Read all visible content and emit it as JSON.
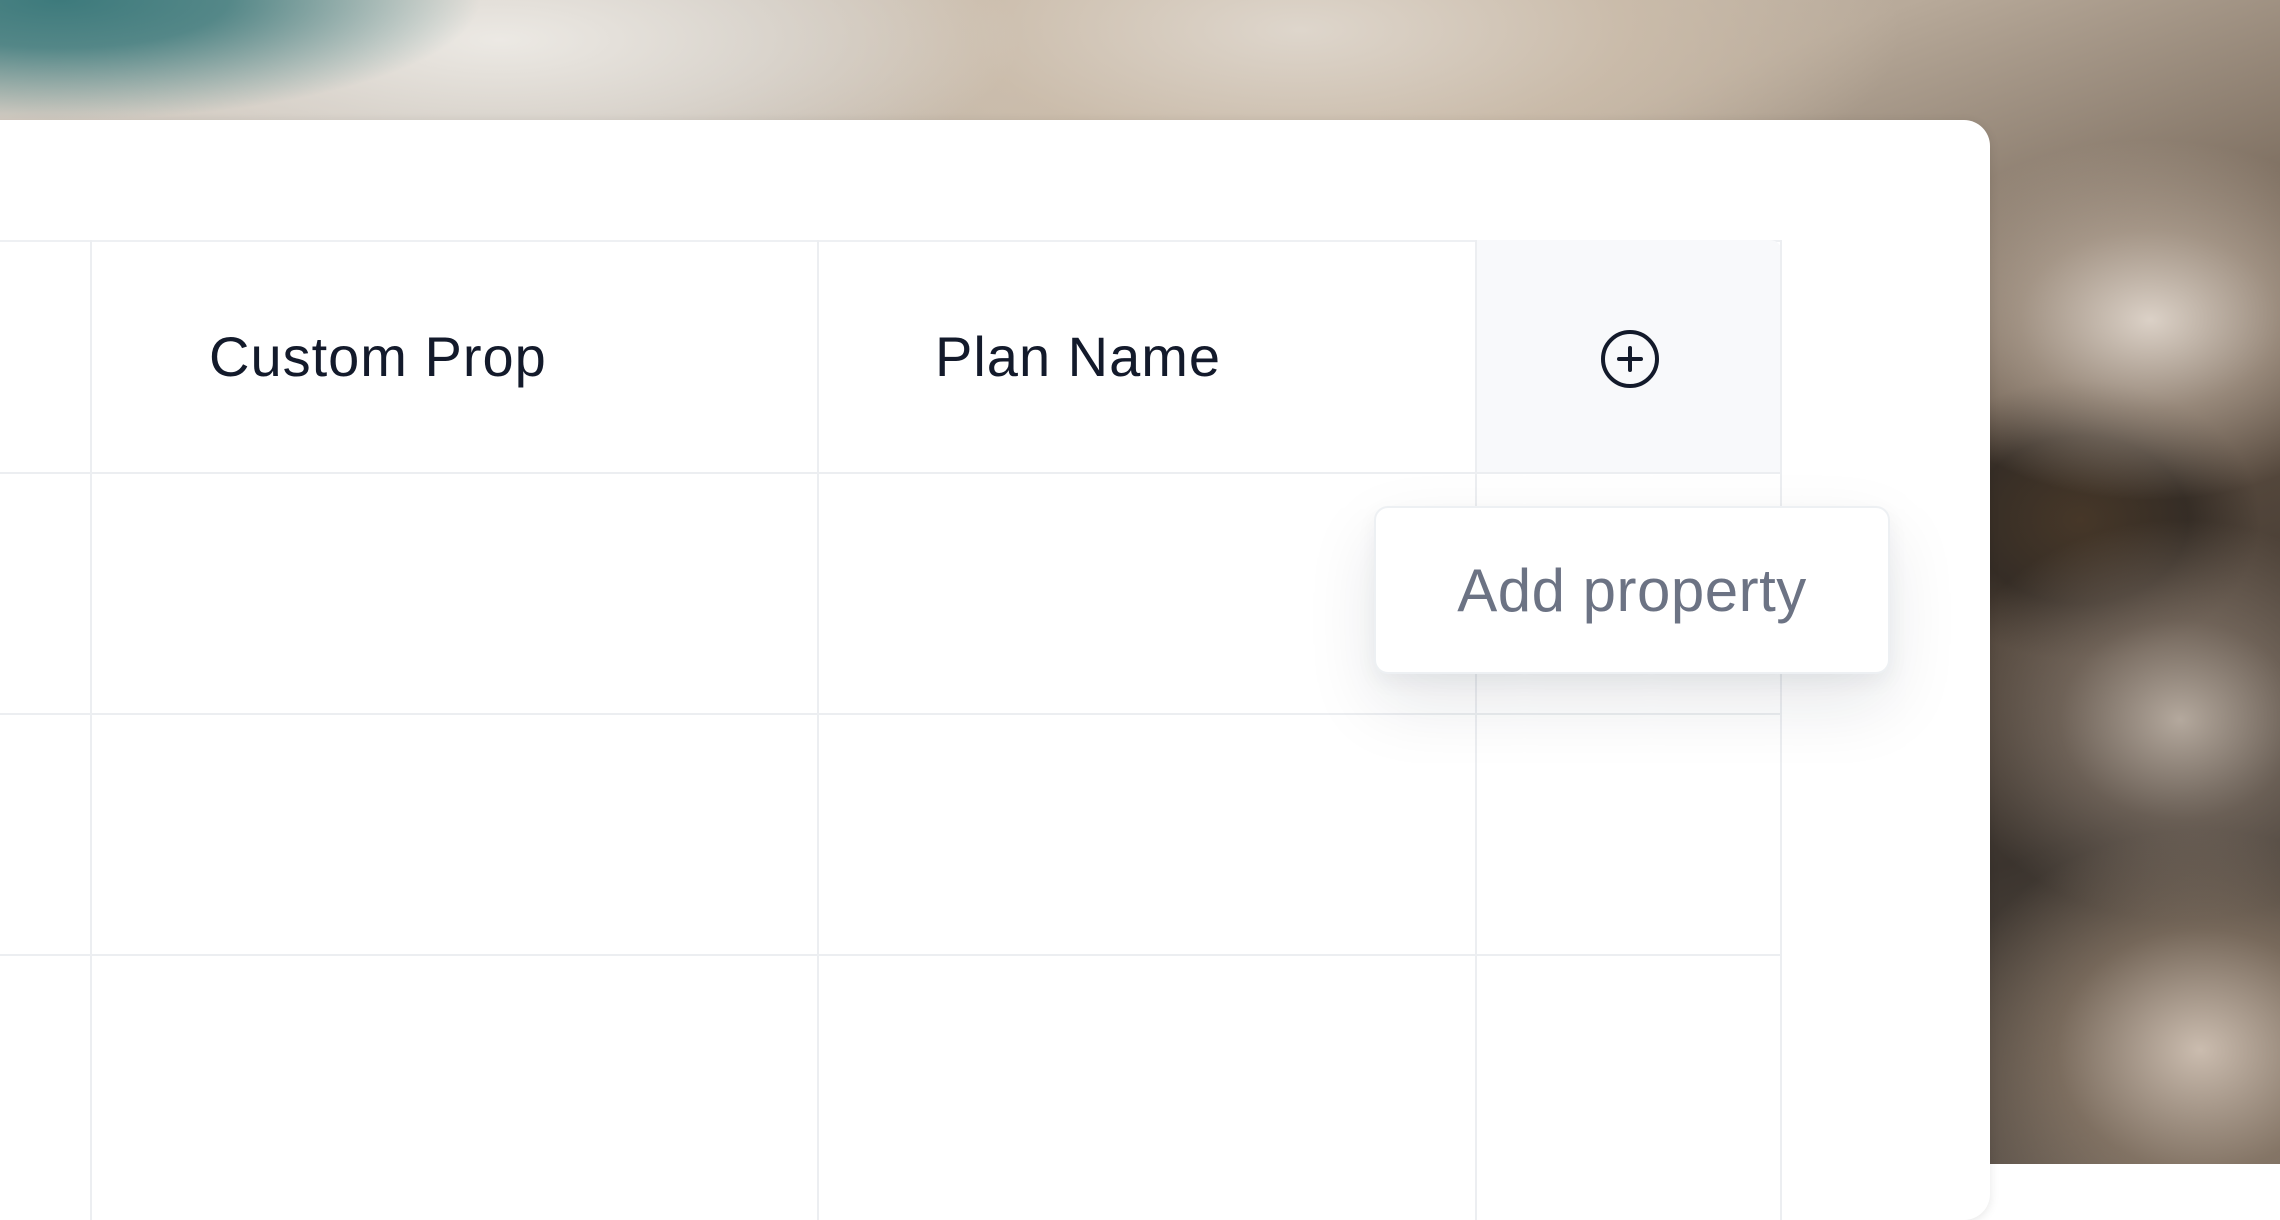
{
  "table": {
    "columns": [
      {
        "label": "Custom Prop"
      },
      {
        "label": "Plan Name"
      }
    ],
    "add_column_icon": "plus-circle-icon"
  },
  "tooltip": {
    "text": "Add property"
  },
  "colors": {
    "header_text": "#131a2b",
    "tooltip_text": "#6c7384",
    "grid_line": "#eceef1",
    "add_column_bg": "#f8f9fb"
  }
}
